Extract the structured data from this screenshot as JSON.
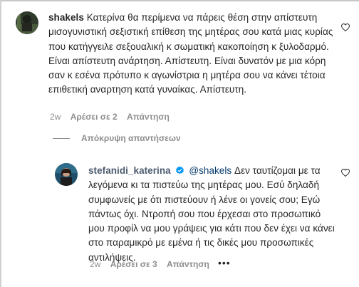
{
  "comment1": {
    "username": "shakels",
    "text": "Κατερίνα θα περίμενα να πάρεις θέση στην απίστευτη μισογυνιστική σεξιστική επίθεση της μητέρας σου κατά μιας κυρίας που κατήγγειλε σεξουαλική κ σωματική κακοποίηση κ ξυλοδαρμό. Είναι απίστευτη ανάρτηση. Απίστευτη. Είναι δυνατόν με μια κόρη σαν κ εσένα πρότυπο κ αγωνίστρια η μητέρα σου να κάνει τέτοια επιθετική αναρτηση κατά γυναίκας. Απίστευτη.",
    "time": "2w",
    "likes": "Αρέσει σε 2",
    "reply": "Απάντηση"
  },
  "hide_replies": "Απόκρυψη απαντήσεων",
  "comment2": {
    "username": "stefanidi_katerina",
    "mention": "@shakels",
    "text": " Δεν ταυτίζομαι με τα λεγόμενα κι τα πιστεύω της μητέρας μου. Εσύ δηλαδή συμφωνείς με ότι πιστεύουν ή λένε οι γονείς σου; Εγώ πάντως όχι. Ντροπή σου που έρχεσαι στο προσωπικό μου προφίλ να μου γράψεις για κάτι που δεν έχει να κάνει στο παραμικρό με εμένα ή τις δικές μου προσωπικές αντιλήψεις.",
    "time": "2w",
    "likes": "Αρέσει σε 3",
    "reply": "Απάντηση",
    "more": "•••"
  },
  "colors": {
    "accent": "#0095f6",
    "muted": "#8e8e8e",
    "text": "#262626"
  }
}
